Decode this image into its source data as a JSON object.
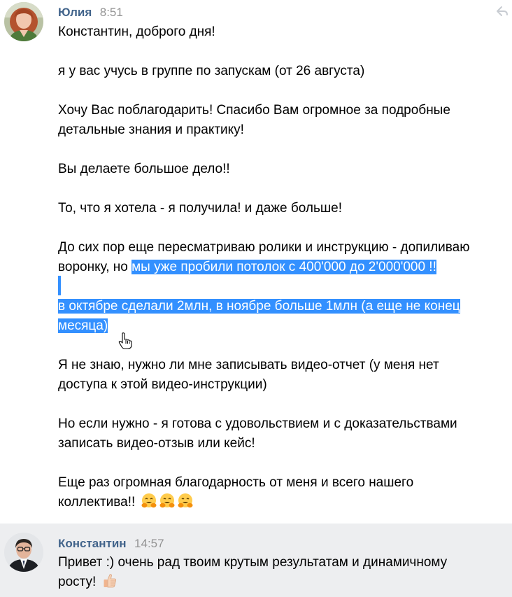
{
  "messages": [
    {
      "author": "Юлия",
      "time": "8:51",
      "lines": [
        "Константин, доброго дня!",
        "я у вас учусь в группе по запускам (от 26 августа)",
        "Хочу Вас поблагодарить! Спасибо Вам огромное за подробные",
        "детальные знания и практику!",
        "Вы делаете большое дело!!",
        "То, что я хотела - я получила! и даже больше!",
        "До сих пор еще пересматриваю ролики и инструкцию - допиливаю",
        "воронку, но ",
        "мы уже пробили потолок с 400'000 до 2'000'000 !!",
        "в октябре сделали 2млн, в ноябре больше 1млн (а еще не конец",
        "месяца)",
        "Я не знаю, нужно ли мне записывать видео-отчет (у меня нет",
        "доступа к этой видео-инструкции)",
        "Но если нужно - я готова с удовольствием и с доказательствами",
        "записать видео-отзыв или кейс!",
        "Еще раз огромная благодарность от меня и всего нашего",
        "коллектива!! "
      ],
      "emoji": [
        "hugging-face",
        "hugging-face",
        "hugging-face"
      ]
    },
    {
      "author": "Константин",
      "time": "14:57",
      "lines": [
        "Привет :) очень рад твоим крутым результатам и динамичному",
        "росту! "
      ],
      "emoji": [
        "thumbs-up"
      ]
    }
  ],
  "colors": {
    "author": "#42648b",
    "time": "#939393",
    "selection": "#3390ff",
    "reply_background": "#edeef0"
  },
  "icons": {
    "corner": "reply-arrow-icon",
    "cursor": "hand-pointer-cursor"
  }
}
